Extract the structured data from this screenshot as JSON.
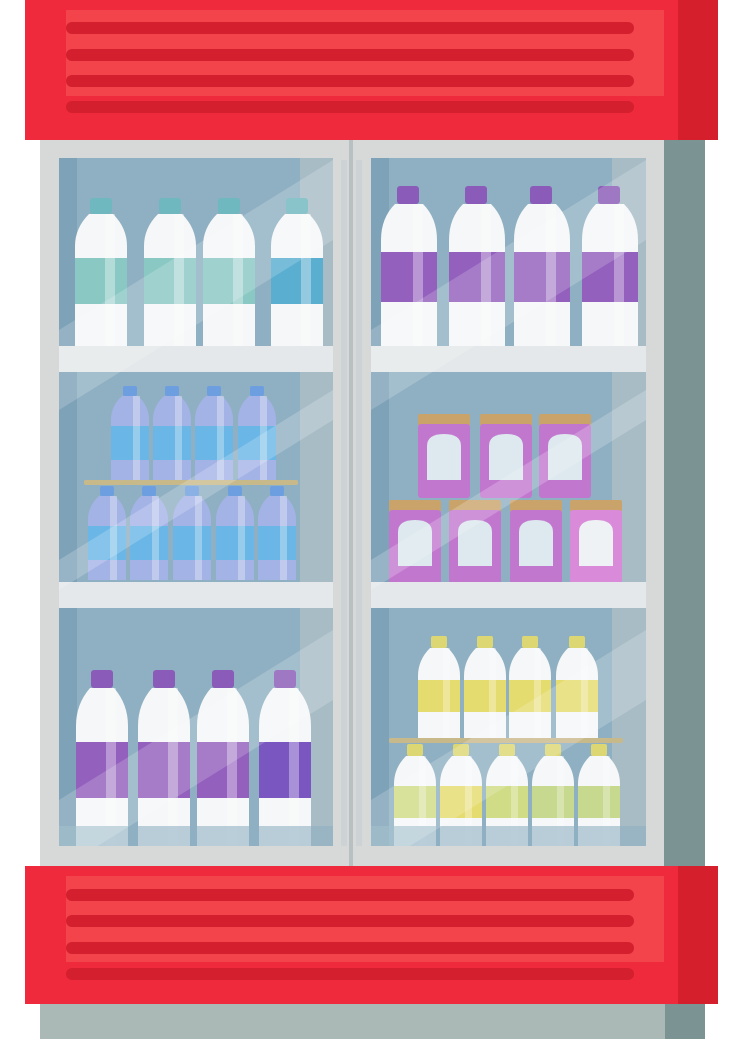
{
  "scene": {
    "subject": "refrigerator-showcase",
    "doors": [
      "left-door",
      "right-door"
    ]
  },
  "colors": {
    "frame_red": "#ef2a3c",
    "frame_red_light": "#f2444a",
    "frame_red_dark": "#d61f2c",
    "stripe": "#d41f2f",
    "body_gray": "#d7d9d9",
    "side_teal": "#7c9393",
    "base_gray": "#aab8b6",
    "interior": "#8fb0c2",
    "shelf": "#e4e8ea",
    "cap_teal": "#6fb8bf",
    "label_teal": "#8ac8c4",
    "cap_purple": "#8a5bb8",
    "label_purple": "#9360bd",
    "bottle_blue": "#8aa8dc",
    "label_blue": "#5aaee0",
    "jar_pink": "#c277cf",
    "jar_lid": "#c9a36a",
    "cap_yellow": "#dcd772",
    "label_yellow": "#e5dc70"
  }
}
